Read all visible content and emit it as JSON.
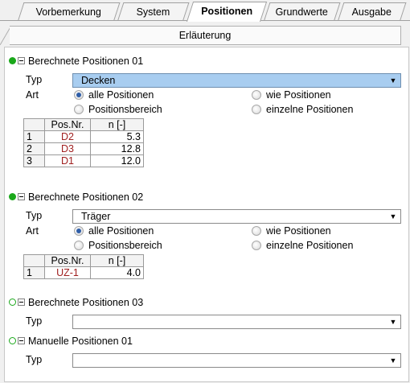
{
  "tabs": [
    {
      "label": "Vorbemerkung"
    },
    {
      "label": "System"
    },
    {
      "label": "Positionen"
    },
    {
      "label": "Grundwerte"
    },
    {
      "label": "Ausgabe"
    }
  ],
  "subtab": {
    "label": "Erläuterung"
  },
  "sections": [
    {
      "title": "Berechnete Positionen 01",
      "typ_label": "Typ",
      "typ_value": "Decken",
      "art_label": "Art",
      "options": {
        "alle": "alle Positionen",
        "wie": "wie Positionen",
        "bereich": "Positionsbereich",
        "einzeln": "einzelne Positionen"
      },
      "selected": "alle Positionen",
      "table": {
        "headers": [
          "Pos.Nr.",
          "n [-]"
        ],
        "rows": [
          {
            "idx": "1",
            "pos": "D2",
            "n": "5.3"
          },
          {
            "idx": "2",
            "pos": "D3",
            "n": "12.8"
          },
          {
            "idx": "3",
            "pos": "D1",
            "n": "12.0"
          }
        ]
      }
    },
    {
      "title": "Berechnete Positionen 02",
      "typ_label": "Typ",
      "typ_value": "Träger",
      "art_label": "Art",
      "options": {
        "alle": "alle Positionen",
        "wie": "wie Positionen",
        "bereich": "Positionsbereich",
        "einzeln": "einzelne Positionen"
      },
      "selected": "alle Positionen",
      "table": {
        "headers": [
          "Pos.Nr.",
          "n [-]"
        ],
        "rows": [
          {
            "idx": "1",
            "pos": "UZ-1",
            "n": "4.0"
          }
        ]
      }
    },
    {
      "title": "Berechnete Positionen 03",
      "typ_label": "Typ",
      "typ_value": ""
    },
    {
      "title": "Manuelle Positionen 01",
      "typ_label": "Typ",
      "typ_value": ""
    }
  ],
  "colors": {
    "status_green": "#1aa81a",
    "selection_blue": "#a8cdf0",
    "position_red": "#a02020"
  },
  "icons": {
    "status": "status-dot-icon",
    "collapse": "collapse-minus-icon",
    "dropdown": "chevron-down-icon"
  }
}
